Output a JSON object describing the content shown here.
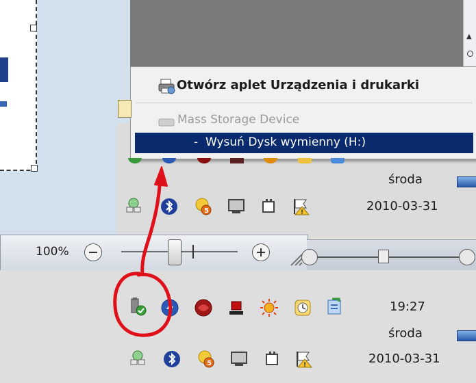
{
  "context_menu": {
    "open_devices_label": "Otwórz aplet Urządzenia i drukarki",
    "device_name": "Mass Storage Device",
    "eject_item_label": "-  Wysuń Dysk wymienny (H:)"
  },
  "tray_upper": {
    "day": "środa",
    "date": "2010-03-31"
  },
  "zoom_bar": {
    "percent": "100%",
    "level_fraction": 0.45
  },
  "tray_lower": {
    "time": "19:27",
    "day": "środa",
    "date": "2010-03-31"
  },
  "annotation": {
    "color": "#e0101a"
  },
  "colors": {
    "menu_highlight": "#0a2a6e",
    "menu_bg": "#f1f1f1",
    "taskbar_bg": "#d9d9d9"
  }
}
